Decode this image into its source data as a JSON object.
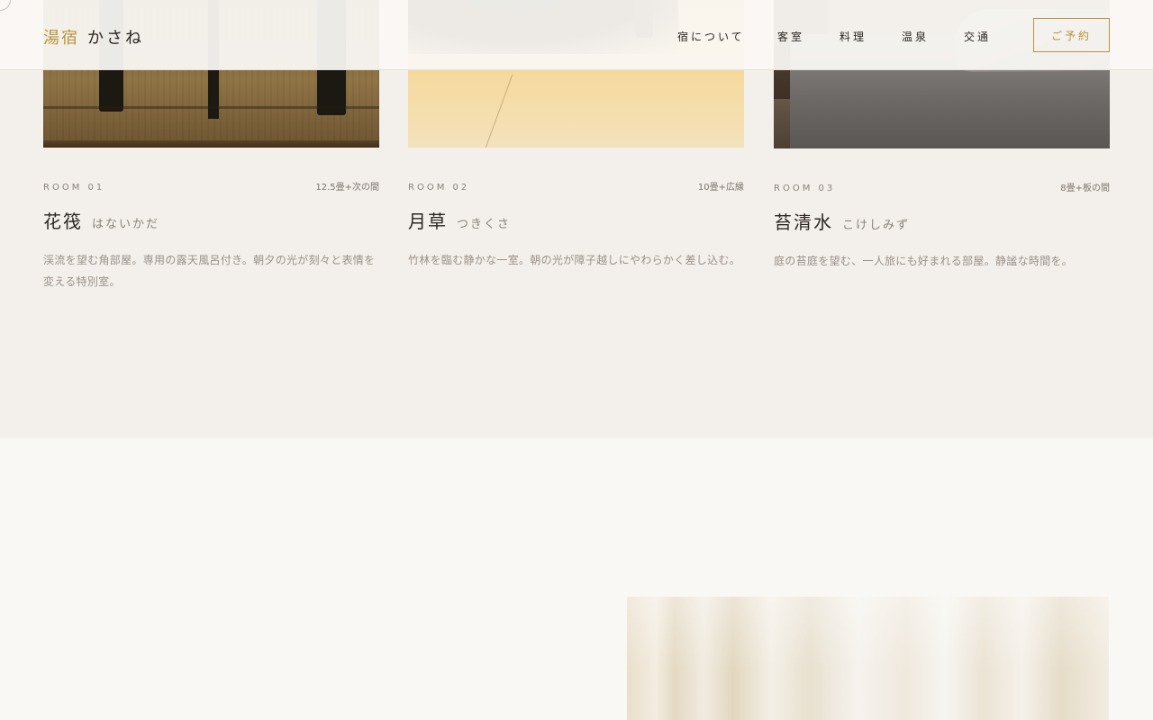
{
  "header": {
    "logo_mark": "湯宿",
    "logo_name": "かさね",
    "nav": [
      "宿について",
      "客室",
      "料理",
      "温泉",
      "交通"
    ],
    "reserve_label": "ご予約",
    "accent_color": "#b8943c"
  },
  "rooms": [
    {
      "number": "ROOM 01",
      "size": "12.5畳+次の間",
      "name": "花筏",
      "reading": "はないかだ",
      "description": "渓流を望む角部屋。専用の露天風呂付き。朝夕の光が刻々と表情を変える特別室。"
    },
    {
      "number": "ROOM 02",
      "size": "10畳+広縁",
      "name": "月草",
      "reading": "つきくさ",
      "description": "竹林を臨む静かな一室。朝の光が障子越しにやわらかく差し込む。"
    },
    {
      "number": "ROOM 03",
      "size": "8畳+板の間",
      "name": "苔清水",
      "reading": "こけしみず",
      "description": "庭の苔庭を望む、一人旅にも好まれる部屋。静謐な時間を。"
    }
  ]
}
